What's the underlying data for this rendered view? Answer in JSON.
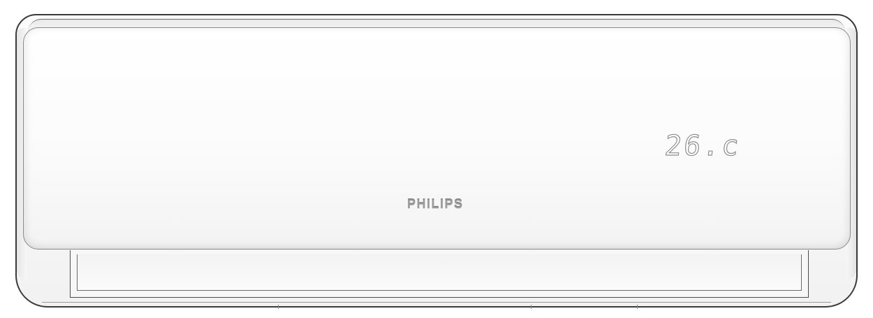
{
  "product": {
    "brand_logo": "PHILIPS",
    "display_reading": "26.c"
  },
  "colors": {
    "body": "#fbfbfb",
    "outline": "#3a3a3a",
    "logo": "#9b9b9b",
    "display_stroke": "#8e8e8e"
  }
}
